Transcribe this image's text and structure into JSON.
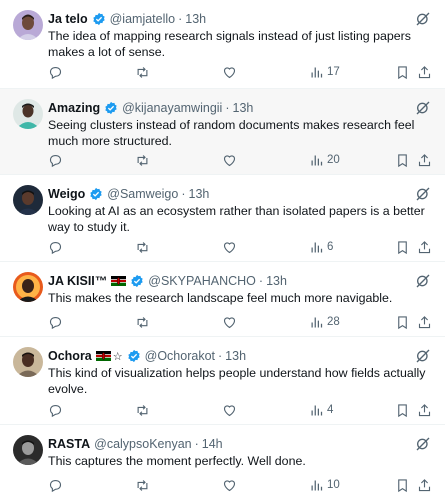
{
  "tweets": [
    {
      "name": "Ja telo",
      "verified": true,
      "handle": "@iamjatello",
      "time": "13h",
      "text": "The idea of mapping research signals instead of just listing papers makes a lot of sense.",
      "views": "17"
    },
    {
      "name": "Amazing",
      "verified": true,
      "handle": "@kijanayamwingii",
      "time": "13h",
      "text": "Seeing clusters instead of random documents makes research feel much more structured.",
      "views": "20"
    },
    {
      "name": "Weigo",
      "verified": true,
      "handle": "@Samweigo",
      "time": "13h",
      "text": "Looking at AI as an ecosystem rather than isolated papers is a better way to study it.",
      "views": "6"
    },
    {
      "name": "JA KISII™",
      "verified": true,
      "handle": "@SKYPAHANCHO",
      "time": "13h",
      "text": "This makes the research landscape feel much more navigable.",
      "views": "28"
    },
    {
      "name": "Ochora",
      "star": "☆",
      "verified": true,
      "handle": "@Ochorakot",
      "time": "13h",
      "text": "This kind of visualization helps people understand how fields actually evolve.",
      "views": "4"
    },
    {
      "name": "RASTA",
      "verified": false,
      "handle": "@calypsoKenyan",
      "time": "14h",
      "text": "This captures the moment perfectly. Well done.",
      "views": "10"
    }
  ],
  "separator": "·",
  "colors": {
    "verified": "#1d9bf0",
    "muted": "#536471",
    "text": "#0f1419",
    "highlight_bg": "#f7f7f7",
    "kenya_black": "#000000",
    "kenya_red": "#bb0000",
    "kenya_green": "#006600"
  },
  "icons": [
    "reply-icon",
    "repost-icon",
    "like-icon",
    "views-icon",
    "bookmark-icon",
    "share-icon",
    "grok-icon",
    "verified-badge-icon",
    "kenya-flag-icon"
  ]
}
